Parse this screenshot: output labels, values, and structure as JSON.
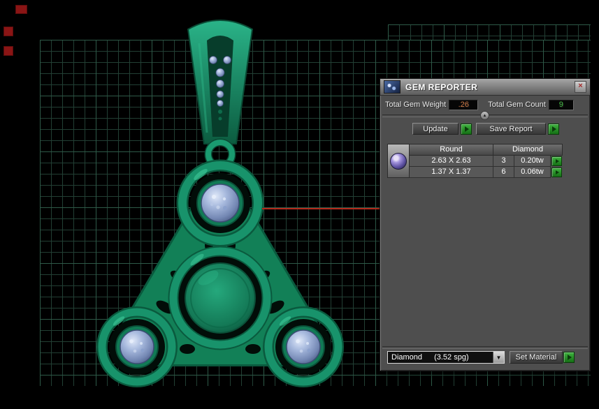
{
  "app": {
    "model_green": "#16926a",
    "gem_blue": "#9db1d8",
    "accent_green": "#2f9e2f",
    "red_guide_color": "#b5281a",
    "grid_color": "#223f34"
  },
  "gem_reporter": {
    "title": "GEM REPORTER",
    "close_label": "×",
    "total_gem_weight_label": "Total Gem Weight",
    "total_gem_weight_value": ".26",
    "total_gem_count_label": "Total Gem Count",
    "total_gem_count_value": "9",
    "collapse_icon": "▲",
    "update_button": "Update",
    "save_report_button": "Save Report",
    "table": {
      "shape_header": "Round",
      "material_header": "Diamond",
      "rows": [
        {
          "size": "2.63 X 2.63",
          "count": "3",
          "total_weight": "0.20tw"
        },
        {
          "size": "1.37 X 1.37",
          "count": "6",
          "total_weight": "0.06tw"
        }
      ]
    },
    "material_name": "Diamond",
    "material_spg": "(3.52 spg)",
    "dropdown_icon": "▼",
    "set_material_button": "Set Material"
  }
}
